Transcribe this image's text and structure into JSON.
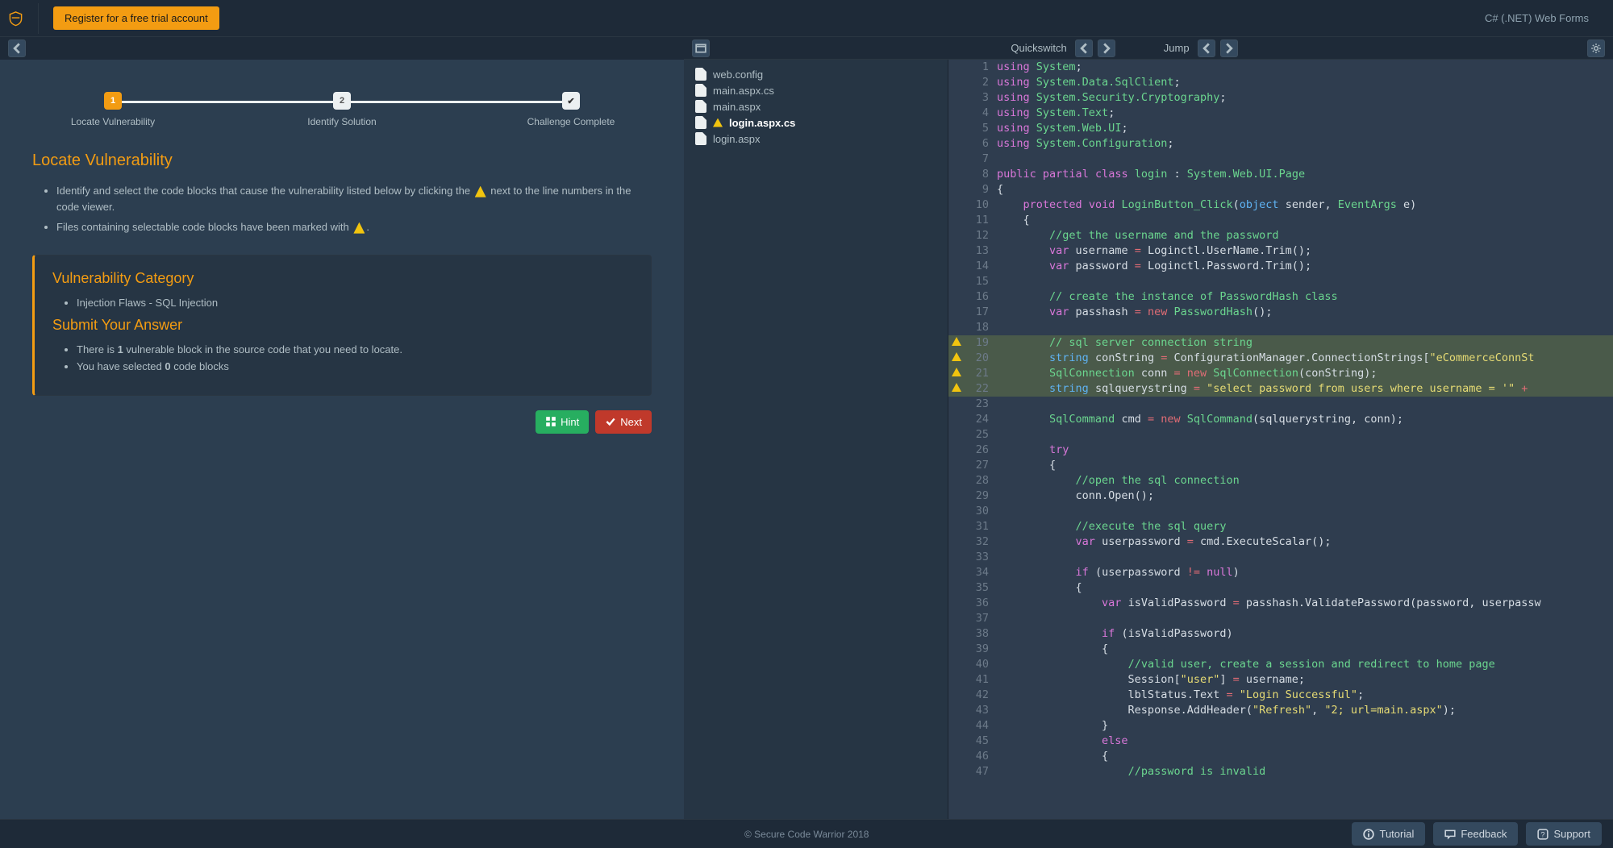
{
  "topbar": {
    "register_label": "Register for a free trial account",
    "tech_label": "C# (.NET) Web Forms"
  },
  "stepper": {
    "step1": {
      "num": "1",
      "label": "Locate Vulnerability"
    },
    "step2": {
      "num": "2",
      "label": "Identify Solution"
    },
    "step3": {
      "check": "✔",
      "label": "Challenge Complete"
    }
  },
  "locate": {
    "title": "Locate Vulnerability",
    "bullet1a": "Identify and select the code blocks that cause the vulnerability listed below by clicking the ",
    "bullet1b": " next to the line numbers in the code viewer.",
    "bullet2a": "Files containing selectable code blocks have been marked with ",
    "bullet2b": "."
  },
  "panel": {
    "cat_title": "Vulnerability Category",
    "cat_item": "Injection Flaws - SQL Injection",
    "submit_title": "Submit Your Answer",
    "ans1a": "There is ",
    "ans1b": "1",
    "ans1c": " vulnerable block in the source code that you need to locate.",
    "ans2a": "You have selected ",
    "ans2b": "0",
    "ans2c": " code blocks"
  },
  "buttons": {
    "hint": "Hint",
    "next": "Next"
  },
  "code_header": {
    "quickswitch": "Quickswitch",
    "jump": "Jump"
  },
  "files": [
    {
      "name": "web.config",
      "warn": false,
      "active": false
    },
    {
      "name": "main.aspx.cs",
      "warn": false,
      "active": false
    },
    {
      "name": "main.aspx",
      "warn": false,
      "active": false
    },
    {
      "name": "login.aspx.cs",
      "warn": true,
      "active": true
    },
    {
      "name": "login.aspx",
      "warn": false,
      "active": false
    }
  ],
  "code": [
    {
      "n": 1,
      "w": false,
      "hl": false,
      "html": "<span class='k-purple'>using</span> <span class='k-green'>System</span>;"
    },
    {
      "n": 2,
      "w": false,
      "hl": false,
      "html": "<span class='k-purple'>using</span> <span class='k-green'>System.Data.SqlClient</span>;"
    },
    {
      "n": 3,
      "w": false,
      "hl": false,
      "html": "<span class='k-purple'>using</span> <span class='k-green'>System.Security.Cryptography</span>;"
    },
    {
      "n": 4,
      "w": false,
      "hl": false,
      "html": "<span class='k-purple'>using</span> <span class='k-green'>System.Text</span>;"
    },
    {
      "n": 5,
      "w": false,
      "hl": false,
      "html": "<span class='k-purple'>using</span> <span class='k-green'>System.Web.UI</span>;"
    },
    {
      "n": 6,
      "w": false,
      "hl": false,
      "html": "<span class='k-purple'>using</span> <span class='k-green'>System.Configuration</span>;"
    },
    {
      "n": 7,
      "w": false,
      "hl": false,
      "html": ""
    },
    {
      "n": 8,
      "w": false,
      "hl": false,
      "html": "<span class='k-purple'>public</span> <span class='k-purple'>partial</span> <span class='k-purple'>class</span> <span class='k-green'>login</span> : <span class='k-green'>System.Web.UI.Page</span>"
    },
    {
      "n": 9,
      "w": false,
      "hl": false,
      "html": "{"
    },
    {
      "n": 10,
      "w": false,
      "hl": false,
      "html": "    <span class='k-purple'>protected</span> <span class='k-purple'>void</span> <span class='k-green'>LoginButton_Click</span>(<span class='k-blue'>object</span> sender, <span class='k-green'>EventArgs</span> e)"
    },
    {
      "n": 11,
      "w": false,
      "hl": false,
      "html": "    {"
    },
    {
      "n": 12,
      "w": false,
      "hl": false,
      "html": "        <span class='k-comment'>//get the username and the password</span>"
    },
    {
      "n": 13,
      "w": false,
      "hl": false,
      "html": "        <span class='k-purple'>var</span> username <span class='k-red'>=</span> Loginctl.UserName.Trim();"
    },
    {
      "n": 14,
      "w": false,
      "hl": false,
      "html": "        <span class='k-purple'>var</span> password <span class='k-red'>=</span> Loginctl.Password.Trim();"
    },
    {
      "n": 15,
      "w": false,
      "hl": false,
      "html": ""
    },
    {
      "n": 16,
      "w": false,
      "hl": false,
      "html": "        <span class='k-comment'>// create the instance of PasswordHash class</span>"
    },
    {
      "n": 17,
      "w": false,
      "hl": false,
      "html": "        <span class='k-purple'>var</span> passhash <span class='k-red'>=</span> <span class='k-red'>new</span> <span class='k-green'>PasswordHash</span>();"
    },
    {
      "n": 18,
      "w": false,
      "hl": false,
      "html": ""
    },
    {
      "n": 19,
      "w": true,
      "hl": true,
      "html": "        <span class='k-comment'>// sql server connection string</span>"
    },
    {
      "n": 20,
      "w": true,
      "hl": true,
      "html": "        <span class='k-blue'>string</span> conString <span class='k-red'>=</span> ConfigurationManager.ConnectionStrings[<span class='k-yellow'>\"eCommerceConnSt</span>"
    },
    {
      "n": 21,
      "w": true,
      "hl": true,
      "html": "        <span class='k-green'>SqlConnection</span> conn <span class='k-red'>=</span> <span class='k-red'>new</span> <span class='k-green'>SqlConnection</span>(conString);"
    },
    {
      "n": 22,
      "w": true,
      "hl": true,
      "html": "        <span class='k-blue'>string</span> sqlquerystring <span class='k-red'>=</span> <span class='k-yellow'>\"select password from users where username = '\"</span> <span class='k-red'>+</span> "
    },
    {
      "n": 23,
      "w": false,
      "hl": false,
      "html": ""
    },
    {
      "n": 24,
      "w": false,
      "hl": false,
      "html": "        <span class='k-green'>SqlCommand</span> cmd <span class='k-red'>=</span> <span class='k-red'>new</span> <span class='k-green'>SqlCommand</span>(sqlquerystring, conn);"
    },
    {
      "n": 25,
      "w": false,
      "hl": false,
      "html": ""
    },
    {
      "n": 26,
      "w": false,
      "hl": false,
      "html": "        <span class='k-purple'>try</span>"
    },
    {
      "n": 27,
      "w": false,
      "hl": false,
      "html": "        {"
    },
    {
      "n": 28,
      "w": false,
      "hl": false,
      "html": "            <span class='k-comment'>//open the sql connection</span>"
    },
    {
      "n": 29,
      "w": false,
      "hl": false,
      "html": "            conn.Open();"
    },
    {
      "n": 30,
      "w": false,
      "hl": false,
      "html": ""
    },
    {
      "n": 31,
      "w": false,
      "hl": false,
      "html": "            <span class='k-comment'>//execute the sql query</span>"
    },
    {
      "n": 32,
      "w": false,
      "hl": false,
      "html": "            <span class='k-purple'>var</span> userpassword <span class='k-red'>=</span> cmd.ExecuteScalar();"
    },
    {
      "n": 33,
      "w": false,
      "hl": false,
      "html": ""
    },
    {
      "n": 34,
      "w": false,
      "hl": false,
      "html": "            <span class='k-purple'>if</span> (userpassword <span class='k-red'>!=</span> <span class='k-purple'>null</span>)"
    },
    {
      "n": 35,
      "w": false,
      "hl": false,
      "html": "            {"
    },
    {
      "n": 36,
      "w": false,
      "hl": false,
      "html": "                <span class='k-purple'>var</span> isValidPassword <span class='k-red'>=</span> passhash.ValidatePassword(password, userpassw"
    },
    {
      "n": 37,
      "w": false,
      "hl": false,
      "html": ""
    },
    {
      "n": 38,
      "w": false,
      "hl": false,
      "html": "                <span class='k-purple'>if</span> (isValidPassword)"
    },
    {
      "n": 39,
      "w": false,
      "hl": false,
      "html": "                {"
    },
    {
      "n": 40,
      "w": false,
      "hl": false,
      "html": "                    <span class='k-comment'>//valid user, create a session and redirect to home page</span>"
    },
    {
      "n": 41,
      "w": false,
      "hl": false,
      "html": "                    Session[<span class='k-yellow'>\"user\"</span>] <span class='k-red'>=</span> username;"
    },
    {
      "n": 42,
      "w": false,
      "hl": false,
      "html": "                    lblStatus.Text <span class='k-red'>=</span> <span class='k-yellow'>\"Login Successful\"</span>;"
    },
    {
      "n": 43,
      "w": false,
      "hl": false,
      "html": "                    Response.AddHeader(<span class='k-yellow'>\"Refresh\"</span>, <span class='k-yellow'>\"2; url=main.aspx\"</span>);"
    },
    {
      "n": 44,
      "w": false,
      "hl": false,
      "html": "                }"
    },
    {
      "n": 45,
      "w": false,
      "hl": false,
      "html": "                <span class='k-purple'>else</span>"
    },
    {
      "n": 46,
      "w": false,
      "hl": false,
      "html": "                {"
    },
    {
      "n": 47,
      "w": false,
      "hl": false,
      "html": "                    <span class='k-comment'>//password is invalid</span>"
    }
  ],
  "footer": {
    "copyright": "© Secure Code Warrior 2018",
    "tutorial": "Tutorial",
    "feedback": "Feedback",
    "support": "Support"
  }
}
